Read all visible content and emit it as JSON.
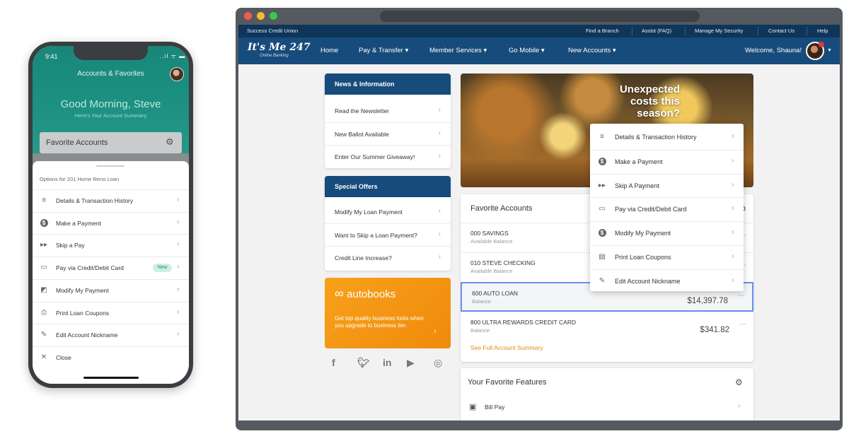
{
  "phone": {
    "time": "9:41",
    "status": "..ıl ᯤ ▬",
    "header_title": "Accounts & Favorites",
    "greeting": "Good Morning, Steve",
    "subgreeting": "Here's Your Account Summary",
    "favorite_accounts_label": "Favorite Accounts",
    "options_title": "Options for 201 Home Reno Loan",
    "options": [
      {
        "label": "Details & Transaction History",
        "icon": "list-check-icon"
      },
      {
        "label": "Make a Payment",
        "icon": "dollar-circle-icon"
      },
      {
        "label": "Skip a Pay",
        "icon": "fast-forward-icon"
      },
      {
        "label": "Pay via Credit/Debit Card",
        "icon": "credit-card-icon",
        "badge": "New"
      },
      {
        "label": "Modify My Payment",
        "icon": "modify-icon"
      },
      {
        "label": "Print Loan Coupons",
        "icon": "printer-icon"
      },
      {
        "label": "Edit Account Nickname",
        "icon": "pencil-icon"
      },
      {
        "label": "Close",
        "icon": "close-icon"
      }
    ],
    "accent_color": "#1b8f80"
  },
  "web": {
    "top_links": {
      "brand": "Success Credit Union",
      "find_branch": "Find a Branch",
      "assist": "Assist (FAQ)",
      "security": "Manage My Security",
      "contact": "Contact Us",
      "help": "Help"
    },
    "logo": "It's Me 247",
    "logo_sub": "Online Banking",
    "nav": {
      "home": "Home",
      "pay_transfer": "Pay & Transfer ▾",
      "member_services": "Member Services ▾",
      "go_mobile": "Go Mobile ▾",
      "new_accounts": "New Accounts ▾",
      "welcome": "Welcome, Shauna!"
    },
    "news": {
      "title": "News & Information",
      "items": [
        "Read the Newsletter",
        "New Ballot Available",
        "Enter Our Summer Giveaway!"
      ]
    },
    "offers": {
      "title": "Special Offers",
      "items": [
        "Modify My Loan Payment",
        "Want to Skip a Loan Payment?",
        "Credit Line Increase?"
      ]
    },
    "autobooks": {
      "logo": "autobooks",
      "text": "Get top quality business tools when you upgrade to business tier."
    },
    "hero_text": "Unexpected costs this season?",
    "favorites": {
      "title": "Favorite Accounts",
      "accounts": [
        {
          "name": "000 SAVINGS",
          "label": "Available Balance",
          "value": ""
        },
        {
          "name": "010 STEVE CHECKING",
          "label": "Available Balance",
          "value": ""
        },
        {
          "name": "600 AUTO LOAN",
          "label": "Balance",
          "value": "$14,397.78"
        },
        {
          "name": "800 ULTRA REWARDS CREDIT CARD",
          "label": "Balance",
          "value": "$341.82"
        }
      ],
      "see_full": "See Full Account Summary"
    },
    "features": {
      "title": "Your Favorite Features",
      "items": [
        "Bill Pay"
      ]
    },
    "dropdown": [
      {
        "label": "Details & Transaction History",
        "icon": "list-check-icon"
      },
      {
        "label": "Make a Payment",
        "icon": "dollar-circle-icon"
      },
      {
        "label": "Skip A Payment",
        "icon": "fast-forward-icon"
      },
      {
        "label": "Pay via Credit/Debit Card",
        "icon": "credit-card-icon"
      },
      {
        "label": "Modify My Payment",
        "icon": "dollar-circle-icon"
      },
      {
        "label": "Print Loan Coupons",
        "icon": "coupon-icon"
      },
      {
        "label": "Edit Account Nickname",
        "icon": "pencil-icon"
      }
    ],
    "colors": {
      "nav_dark": "#0e355a",
      "nav": "#174b7b",
      "orange": "#f08a0c",
      "selected_border": "#6c8ef0"
    }
  }
}
